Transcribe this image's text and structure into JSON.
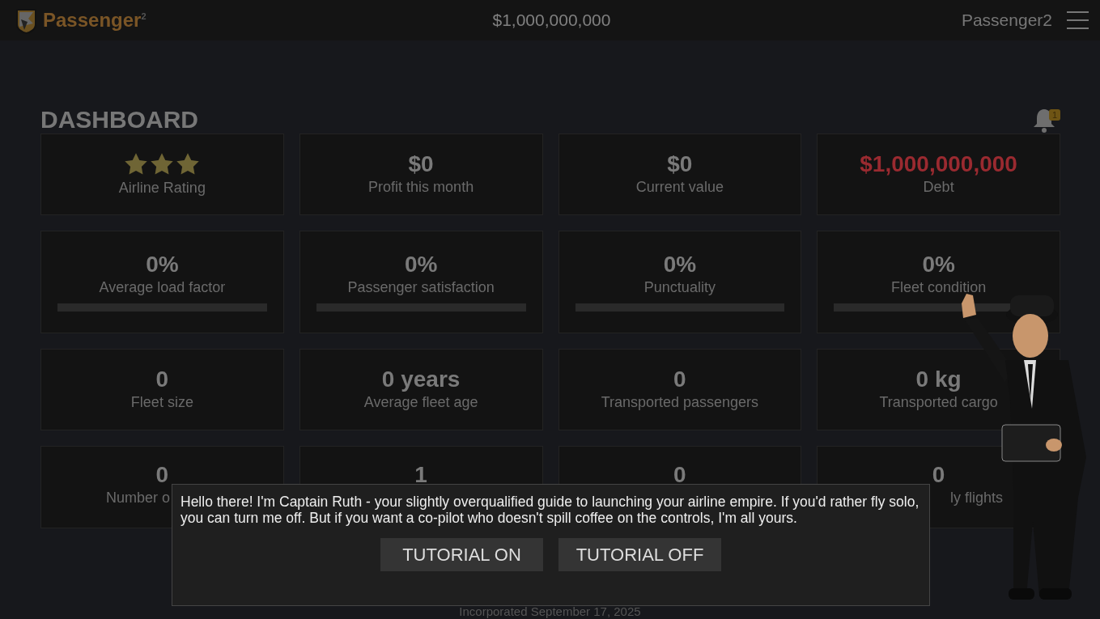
{
  "header": {
    "logo": "Passenger$^{2}$",
    "balance": "$1,000,000,000",
    "user": "Passenger2"
  },
  "title": "DASHBOARD",
  "notifications": {
    "count": "1"
  },
  "stats": [
    {
      "kind": "stars",
      "stars": 3,
      "label": "Airline Rating"
    },
    {
      "kind": "value",
      "value": "$0",
      "label": "Profit this month"
    },
    {
      "kind": "value",
      "value": "$0",
      "label": "Current value"
    },
    {
      "kind": "value",
      "value": "$1,000,000,000",
      "label": "Debt",
      "color": "#9a2a30"
    },
    {
      "kind": "meter",
      "value": "0%",
      "label": "Average load factor",
      "level": 0
    },
    {
      "kind": "meter",
      "value": "0%",
      "label": "Passenger satisfaction",
      "level": 0
    },
    {
      "kind": "meter",
      "value": "0%",
      "label": "Punctuality",
      "level": 0
    },
    {
      "kind": "meter",
      "value": "0%",
      "label": "Fleet condition",
      "level": 0
    },
    {
      "kind": "value",
      "value": "0",
      "label": "Fleet size"
    },
    {
      "kind": "value",
      "value": "0 years",
      "label": "Average fleet age"
    },
    {
      "kind": "value",
      "value": "0",
      "label": "Transported passengers"
    },
    {
      "kind": "value",
      "value": "0 kg",
      "label": "Transported cargo"
    },
    {
      "kind": "value",
      "value": "0",
      "label": "Number o"
    },
    {
      "kind": "value",
      "value": "1"
    },
    {
      "kind": "value",
      "value": "0"
    },
    {
      "kind": "value",
      "value": "0",
      "label": "ly flights"
    }
  ],
  "dialog": {
    "text": "Hello there! I'm Captain Ruth - your slightly overqualified guide to launching your airline empire. If you'd rather fly solo, you can turn me off. But if you want a co-pilot who doesn't spill coffee on the controls, I'm all yours.",
    "buttons": [
      "TUTORIAL ON",
      "TUTORIAL OFF"
    ]
  },
  "footer": "Incorporated September 17, 2025"
}
